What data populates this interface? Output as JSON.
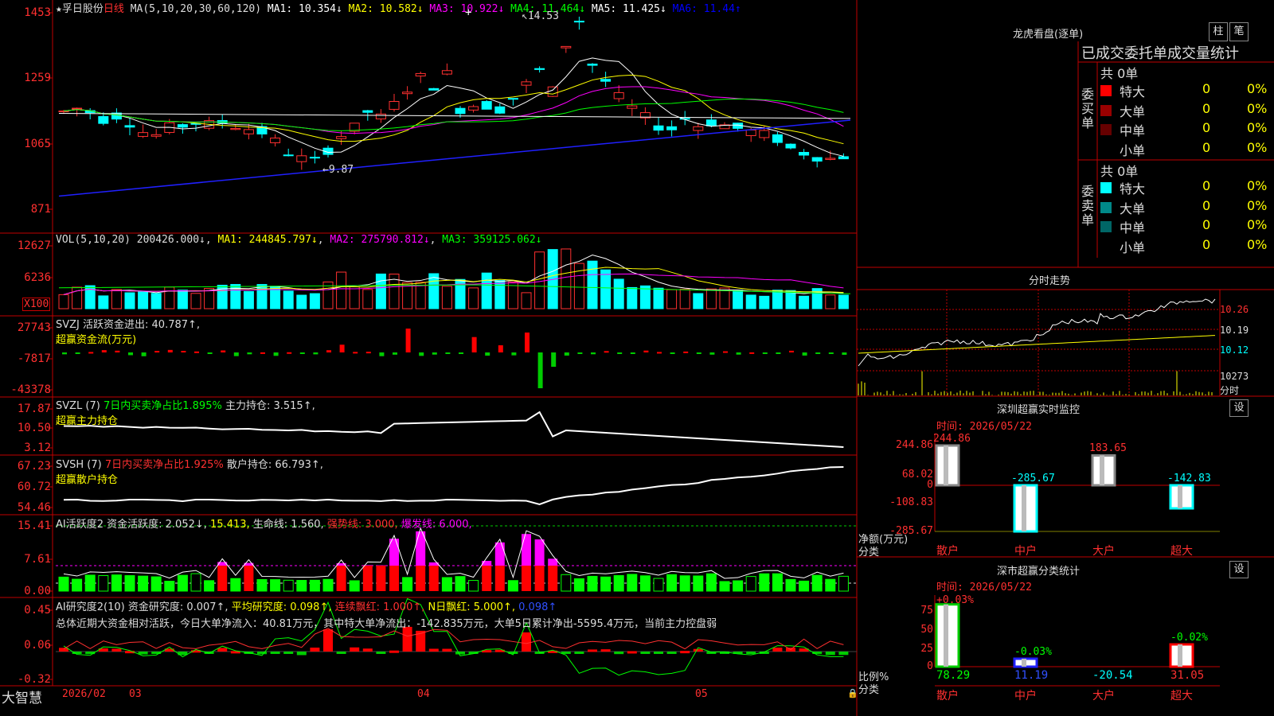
{
  "main_chart": {
    "title_star": "★",
    "stock_name": "孚日股份",
    "period": "日线",
    "ma_params": "MA(5,10,20,30,60,120)",
    "ma": [
      {
        "label": "MA1:",
        "value": "10.354↓",
        "color": "#ffffff"
      },
      {
        "label": "MA2:",
        "value": "10.582↓",
        "color": "#ffff00"
      },
      {
        "label": "MA3:",
        "value": "10.922↓",
        "color": "#ff00ff"
      },
      {
        "label": "MA4:",
        "value": "11.464↓",
        "color": "#00ff00"
      },
      {
        "label": "MA5:",
        "value": "11.425↓",
        "color": "#ffffff"
      },
      {
        "label": "MA6:",
        "value": "11.44↑",
        "color": "#0000ff"
      }
    ],
    "y_ticks": [
      "1453",
      "1259",
      "1065",
      "871"
    ],
    "high_mark": "14.53",
    "low_mark": "9.87"
  },
  "vol_panel": {
    "label": "VOL(5,10,20)",
    "value": "200426.000↓",
    "ma1": "MA1: 244845.797↓",
    "ma2": "MA2: 275790.812↓",
    "ma3": "MA3: 359125.062↓",
    "y_ticks": [
      "12627",
      "6236",
      "X100"
    ]
  },
  "svzj_panel": {
    "label": "SVZJ  活跃资金进出: 40.787↑,",
    "sub": "超赢资金流(万元)",
    "y_ticks": [
      "27743",
      "-7817",
      "-43378"
    ]
  },
  "svzl_panel": {
    "label": "SVZL (7)",
    "green_text": "7日内买卖净占比1.895%",
    "value": "主力持仓: 3.515↑,",
    "sub": "超赢主力持仓",
    "y_ticks": [
      "17.87",
      "10.50",
      "3.12"
    ]
  },
  "svsh_panel": {
    "label": "SVSH (7)",
    "red_text": "7日内买卖净占比1.925%",
    "value": "散户持仓: 66.793↑,",
    "sub": "超赢散户持仓",
    "y_ticks": [
      "67.23",
      "60.72",
      "54.46"
    ]
  },
  "ai_active_panel": {
    "label": "AI活跃度2 资金活跃度: 2.052↓,",
    "v2": "15.413,",
    "v3": "生命线: 1.560,",
    "v4": "强势线: 3.000,",
    "v5": "爆发线: 6.000,",
    "y_ticks": [
      "15.41",
      "7.61",
      "0.00"
    ]
  },
  "ai_research_panel": {
    "label": "AI研究度2(10) 资金研究度: 0.007↑,",
    "v2": "平均研究度: 0.098↑,",
    "v3": "连续飘红: 1.000↑,",
    "v4": "N日飘红: 5.000↑,",
    "v5": "0.098↑",
    "summary": "总体近期大资金相对活跃，今日大单净流入：40.81万元，其中特大单净流出：-142.835万元，大单5日累计净出-5595.4万元，当前主力控盘弱",
    "y_ticks": [
      "0.45",
      "0.06",
      "-0.32"
    ]
  },
  "bottom_bar": {
    "logo": "大智慧",
    "dates": [
      "2026/02",
      "03",
      "04",
      "05"
    ]
  },
  "right_panel": {
    "title": "龙虎看盘(逐单)",
    "btn_zhu": "柱",
    "btn_bi": "笔",
    "subtitle": "已成交委托单成交量统计",
    "buy": {
      "side": "委买单",
      "total": "共 0单",
      "rows": [
        {
          "name": "特大",
          "count": "0",
          "pct": "0%",
          "color": "#ff0000"
        },
        {
          "name": "大单",
          "count": "0",
          "pct": "0%",
          "color": "#990000"
        },
        {
          "name": "中单",
          "count": "0",
          "pct": "0%",
          "color": "#660000"
        },
        {
          "name": "小单",
          "count": "0",
          "pct": "0%",
          "color": "#000000"
        }
      ]
    },
    "sell": {
      "side": "委卖单",
      "total": "共 0单",
      "rows": [
        {
          "name": "特大",
          "count": "0",
          "pct": "0%",
          "color": "#00ffff"
        },
        {
          "name": "大单",
          "count": "0",
          "pct": "0%",
          "color": "#008888"
        },
        {
          "name": "中单",
          "count": "0",
          "pct": "0%",
          "color": "#006666"
        },
        {
          "name": "小单",
          "count": "0",
          "pct": "0%",
          "color": "#000000"
        }
      ]
    },
    "intraday": {
      "title": "分时走势",
      "y_ticks": [
        "10.26",
        "10.19",
        "10.12"
      ],
      "vol_tick": "10273",
      "vol_label": "分时"
    },
    "sz_monitor": {
      "title": "深圳超赢实时监控",
      "btn": "设",
      "time": "时间: 2026/05/22",
      "y_ticks": [
        "244.86",
        "68.02",
        "0",
        "-108.83",
        "-285.67"
      ],
      "y_label": "净额(万元)",
      "x_label": "分类",
      "chart_data": {
        "type": "bar",
        "categories": [
          "散户",
          "中户",
          "大户",
          "超大"
        ],
        "values": [
          244.86,
          -285.67,
          183.65,
          -142.83
        ],
        "ylim": [
          -285.67,
          244.86
        ]
      }
    },
    "sz_category": {
      "title": "深市超赢分类统计",
      "btn": "设",
      "time": "时间: 2026/05/22",
      "y_ticks": [
        "75",
        "50",
        "25",
        "0"
      ],
      "y_label": "比例%",
      "x_label": "分类",
      "chart_data": {
        "type": "bar",
        "categories": [
          "散户",
          "中户",
          "大户",
          "超大"
        ],
        "values": [
          78.29,
          11.19,
          -20.54,
          31.05
        ],
        "changes": [
          "+0.03%",
          "-0.03%",
          "",
          "-0.02%"
        ]
      }
    }
  }
}
